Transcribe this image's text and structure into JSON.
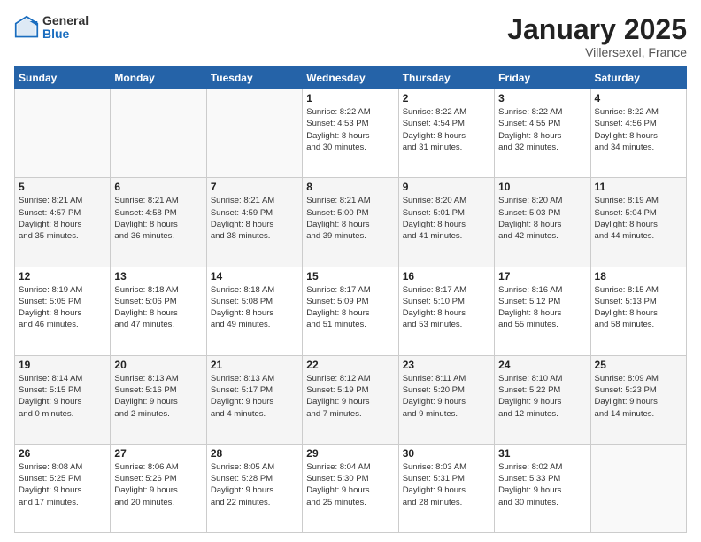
{
  "logo": {
    "general": "General",
    "blue": "Blue"
  },
  "title": "January 2025",
  "subtitle": "Villersexel, France",
  "days_header": [
    "Sunday",
    "Monday",
    "Tuesday",
    "Wednesday",
    "Thursday",
    "Friday",
    "Saturday"
  ],
  "weeks": [
    [
      {
        "num": "",
        "info": ""
      },
      {
        "num": "",
        "info": ""
      },
      {
        "num": "",
        "info": ""
      },
      {
        "num": "1",
        "info": "Sunrise: 8:22 AM\nSunset: 4:53 PM\nDaylight: 8 hours\nand 30 minutes."
      },
      {
        "num": "2",
        "info": "Sunrise: 8:22 AM\nSunset: 4:54 PM\nDaylight: 8 hours\nand 31 minutes."
      },
      {
        "num": "3",
        "info": "Sunrise: 8:22 AM\nSunset: 4:55 PM\nDaylight: 8 hours\nand 32 minutes."
      },
      {
        "num": "4",
        "info": "Sunrise: 8:22 AM\nSunset: 4:56 PM\nDaylight: 8 hours\nand 34 minutes."
      }
    ],
    [
      {
        "num": "5",
        "info": "Sunrise: 8:21 AM\nSunset: 4:57 PM\nDaylight: 8 hours\nand 35 minutes."
      },
      {
        "num": "6",
        "info": "Sunrise: 8:21 AM\nSunset: 4:58 PM\nDaylight: 8 hours\nand 36 minutes."
      },
      {
        "num": "7",
        "info": "Sunrise: 8:21 AM\nSunset: 4:59 PM\nDaylight: 8 hours\nand 38 minutes."
      },
      {
        "num": "8",
        "info": "Sunrise: 8:21 AM\nSunset: 5:00 PM\nDaylight: 8 hours\nand 39 minutes."
      },
      {
        "num": "9",
        "info": "Sunrise: 8:20 AM\nSunset: 5:01 PM\nDaylight: 8 hours\nand 41 minutes."
      },
      {
        "num": "10",
        "info": "Sunrise: 8:20 AM\nSunset: 5:03 PM\nDaylight: 8 hours\nand 42 minutes."
      },
      {
        "num": "11",
        "info": "Sunrise: 8:19 AM\nSunset: 5:04 PM\nDaylight: 8 hours\nand 44 minutes."
      }
    ],
    [
      {
        "num": "12",
        "info": "Sunrise: 8:19 AM\nSunset: 5:05 PM\nDaylight: 8 hours\nand 46 minutes."
      },
      {
        "num": "13",
        "info": "Sunrise: 8:18 AM\nSunset: 5:06 PM\nDaylight: 8 hours\nand 47 minutes."
      },
      {
        "num": "14",
        "info": "Sunrise: 8:18 AM\nSunset: 5:08 PM\nDaylight: 8 hours\nand 49 minutes."
      },
      {
        "num": "15",
        "info": "Sunrise: 8:17 AM\nSunset: 5:09 PM\nDaylight: 8 hours\nand 51 minutes."
      },
      {
        "num": "16",
        "info": "Sunrise: 8:17 AM\nSunset: 5:10 PM\nDaylight: 8 hours\nand 53 minutes."
      },
      {
        "num": "17",
        "info": "Sunrise: 8:16 AM\nSunset: 5:12 PM\nDaylight: 8 hours\nand 55 minutes."
      },
      {
        "num": "18",
        "info": "Sunrise: 8:15 AM\nSunset: 5:13 PM\nDaylight: 8 hours\nand 58 minutes."
      }
    ],
    [
      {
        "num": "19",
        "info": "Sunrise: 8:14 AM\nSunset: 5:15 PM\nDaylight: 9 hours\nand 0 minutes."
      },
      {
        "num": "20",
        "info": "Sunrise: 8:13 AM\nSunset: 5:16 PM\nDaylight: 9 hours\nand 2 minutes."
      },
      {
        "num": "21",
        "info": "Sunrise: 8:13 AM\nSunset: 5:17 PM\nDaylight: 9 hours\nand 4 minutes."
      },
      {
        "num": "22",
        "info": "Sunrise: 8:12 AM\nSunset: 5:19 PM\nDaylight: 9 hours\nand 7 minutes."
      },
      {
        "num": "23",
        "info": "Sunrise: 8:11 AM\nSunset: 5:20 PM\nDaylight: 9 hours\nand 9 minutes."
      },
      {
        "num": "24",
        "info": "Sunrise: 8:10 AM\nSunset: 5:22 PM\nDaylight: 9 hours\nand 12 minutes."
      },
      {
        "num": "25",
        "info": "Sunrise: 8:09 AM\nSunset: 5:23 PM\nDaylight: 9 hours\nand 14 minutes."
      }
    ],
    [
      {
        "num": "26",
        "info": "Sunrise: 8:08 AM\nSunset: 5:25 PM\nDaylight: 9 hours\nand 17 minutes."
      },
      {
        "num": "27",
        "info": "Sunrise: 8:06 AM\nSunset: 5:26 PM\nDaylight: 9 hours\nand 20 minutes."
      },
      {
        "num": "28",
        "info": "Sunrise: 8:05 AM\nSunset: 5:28 PM\nDaylight: 9 hours\nand 22 minutes."
      },
      {
        "num": "29",
        "info": "Sunrise: 8:04 AM\nSunset: 5:30 PM\nDaylight: 9 hours\nand 25 minutes."
      },
      {
        "num": "30",
        "info": "Sunrise: 8:03 AM\nSunset: 5:31 PM\nDaylight: 9 hours\nand 28 minutes."
      },
      {
        "num": "31",
        "info": "Sunrise: 8:02 AM\nSunset: 5:33 PM\nDaylight: 9 hours\nand 30 minutes."
      },
      {
        "num": "",
        "info": ""
      }
    ]
  ]
}
